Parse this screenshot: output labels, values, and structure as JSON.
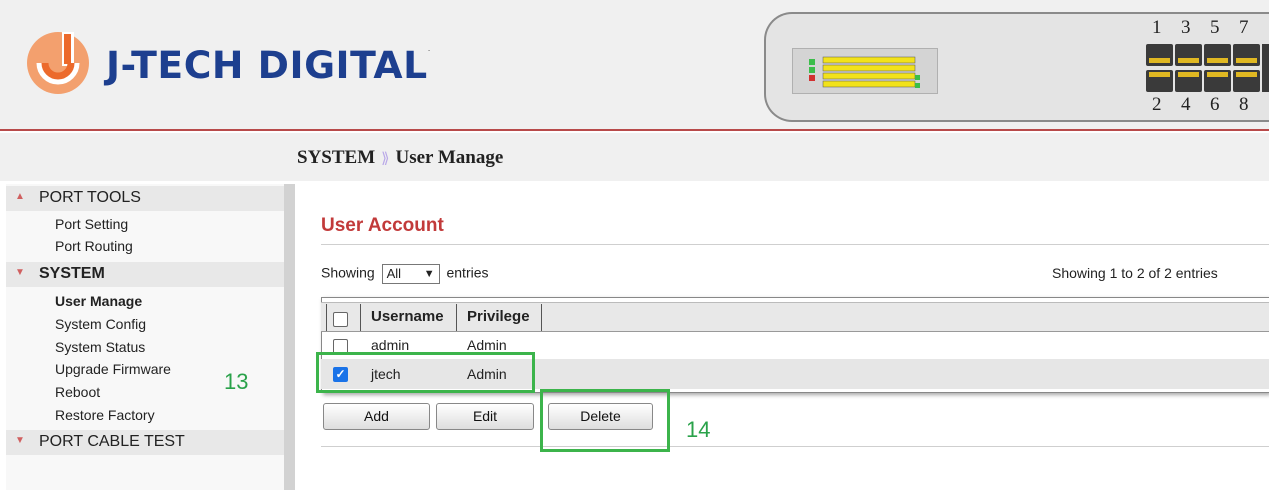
{
  "brand": {
    "name": "J-TECH DIGITAL",
    "trademark": "."
  },
  "ports": {
    "top_numbers": [
      "1",
      "3",
      "5",
      "7"
    ],
    "bottom_numbers": [
      "2",
      "4",
      "6",
      "8"
    ]
  },
  "breadcrumb": {
    "section": "SYSTEM",
    "separator": "⟫",
    "page": "User Manage"
  },
  "sidebar": {
    "sections": [
      {
        "label": "PORT TOOLS",
        "expanded": true,
        "items": [
          "Port Setting",
          "Port Routing"
        ]
      },
      {
        "label": "SYSTEM",
        "expanded": true,
        "items": [
          "User Manage",
          "System Config",
          "System Status",
          "Upgrade Firmware",
          "Reboot",
          "Restore Factory"
        ],
        "current": "User Manage"
      },
      {
        "label": "PORT CABLE TEST",
        "expanded": false,
        "items": []
      }
    ]
  },
  "main": {
    "title": "User Account",
    "showing_label": "Showing",
    "length_select": {
      "value": "All"
    },
    "entries_label": "entries",
    "info": "Showing 1 to 2 of 2 entries",
    "table": {
      "columns": [
        "Username",
        "Privilege"
      ],
      "rows": [
        {
          "username": "admin",
          "privilege": "Admin",
          "checked": false
        },
        {
          "username": "jtech",
          "privilege": "Admin",
          "checked": true
        }
      ]
    },
    "buttons": {
      "add": "Add",
      "edit": "Edit",
      "delete": "Delete"
    }
  },
  "annotations": {
    "left": "13",
    "right": "14"
  },
  "colors": {
    "accent_red": "#c23a3a",
    "brand_blue": "#1d3f8f",
    "logo_orange": "#f07a3c",
    "highlight_green": "#3cb44b",
    "checkbox_blue": "#1a73e8"
  }
}
